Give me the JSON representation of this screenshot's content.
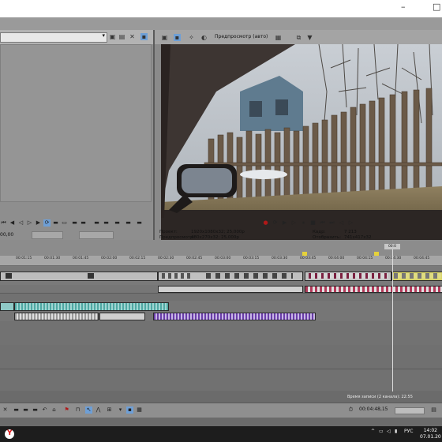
{
  "titlebar": {
    "minimize": "–",
    "maximize": "□"
  },
  "preview": {
    "quality_label": "Предпросмотр (авто)"
  },
  "info": {
    "project_label": "Проект:",
    "project_value": "1920x1080x32; 25,000p",
    "preview_label": "Предпросмотр:",
    "preview_value": "480x270x32; 25,000p",
    "frame_label": "Кадр:",
    "frame_value": "7 213",
    "display_label": "Отобразить:",
    "display_value": "741x417x32"
  },
  "trimmer": {
    "time": "00,00"
  },
  "ruler": {
    "ticks": [
      "00:01:15",
      "00:01:30",
      "00:01:45",
      "00:02:00",
      "00:02:15",
      "00:02:30",
      "00:02:45",
      "00:03:00",
      "00:03:15",
      "00:03:30",
      "00:03:45",
      "00:04:00",
      "00:04:15",
      "00:04:30",
      "00:04:45",
      "00:05:00"
    ]
  },
  "playhead": {
    "label": "00:0"
  },
  "bottom": {
    "time": "00:04:48,15"
  },
  "status": {
    "record": "Время записи (2 канала): 22:55"
  },
  "taskbar": {
    "lang": "РУС",
    "time": "14:02",
    "date": "07.01.20"
  },
  "icons": {
    "yandex": "yandex-browser-icon",
    "close": "close-icon"
  }
}
